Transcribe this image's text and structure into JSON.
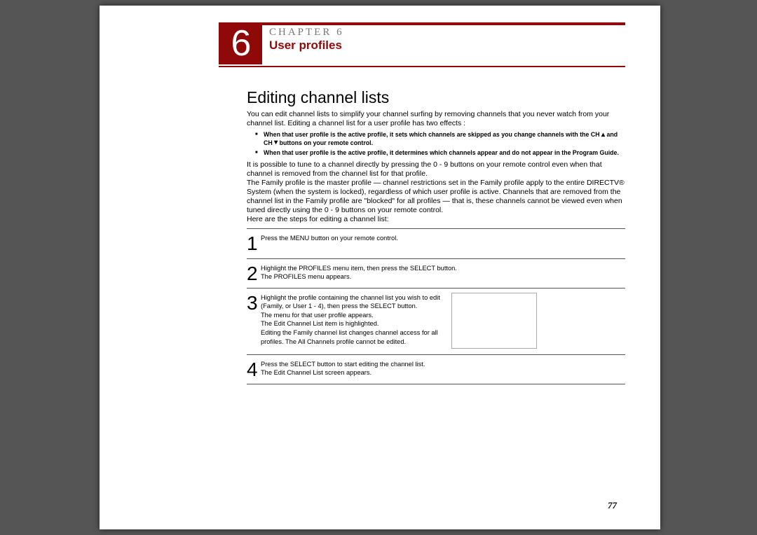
{
  "chapter": {
    "number": "6",
    "label": "CHAPTER 6",
    "title": "User profiles"
  },
  "section": {
    "heading": "Editing channel lists",
    "intro": "You can edit channel lists to simplify your channel surfing by removing channels that you never watch from your channel list. Editing a channel list for a user profile has two effects :",
    "bullets": [
      {
        "pre": "When that user profile is the active profile, it sets which channels are skipped as you change channels with the CH ",
        "mid1": "▴",
        "tween": " and CH ",
        "mid2": "▾",
        "post": " buttons on your remote control."
      },
      {
        "pre": "When that user profile is the active profile, it determines which channels appear and do not appear in the Program Guide.",
        "mid1": "",
        "tween": "",
        "mid2": "",
        "post": ""
      }
    ],
    "after_bullets": "It is possible to tune to a channel directly by pressing the 0 - 9 buttons on your remote control even when that channel is removed from the channel list for that profile.\nThe Family profile is the master profile — channel restrictions set in the Family profile apply to the entire DIRECTV® System (when the system is locked), regardless of which user profile is active. Channels that are removed from the channel list in the Family profile are \"blocked\" for all profiles — that is, these channels cannot be viewed even when tuned directly using the 0 - 9 buttons on your remote control.\nHere are the steps for editing a channel list:",
    "steps": [
      {
        "num": "1",
        "text": "Press the MENU button on your remote control.",
        "image": false
      },
      {
        "num": "2",
        "text": "Highlight the PROFILES menu item, then press the SELECT button.\nThe PROFILES menu appears.",
        "image": false
      },
      {
        "num": "3",
        "text": "Highlight the profile containing the channel list you wish to edit (Family, or User 1 - 4), then press the SELECT button.\nThe menu for that user profile appears.\nThe Edit Channel List item is highlighted.\nEditing the Family channel list changes channel access for all profiles. The All Channels profile cannot be edited.",
        "image": true
      },
      {
        "num": "4",
        "text": "Press the SELECT button to start editing the channel list.\nThe Edit Channel List screen appears.",
        "image": false
      }
    ]
  },
  "page_number": "77"
}
